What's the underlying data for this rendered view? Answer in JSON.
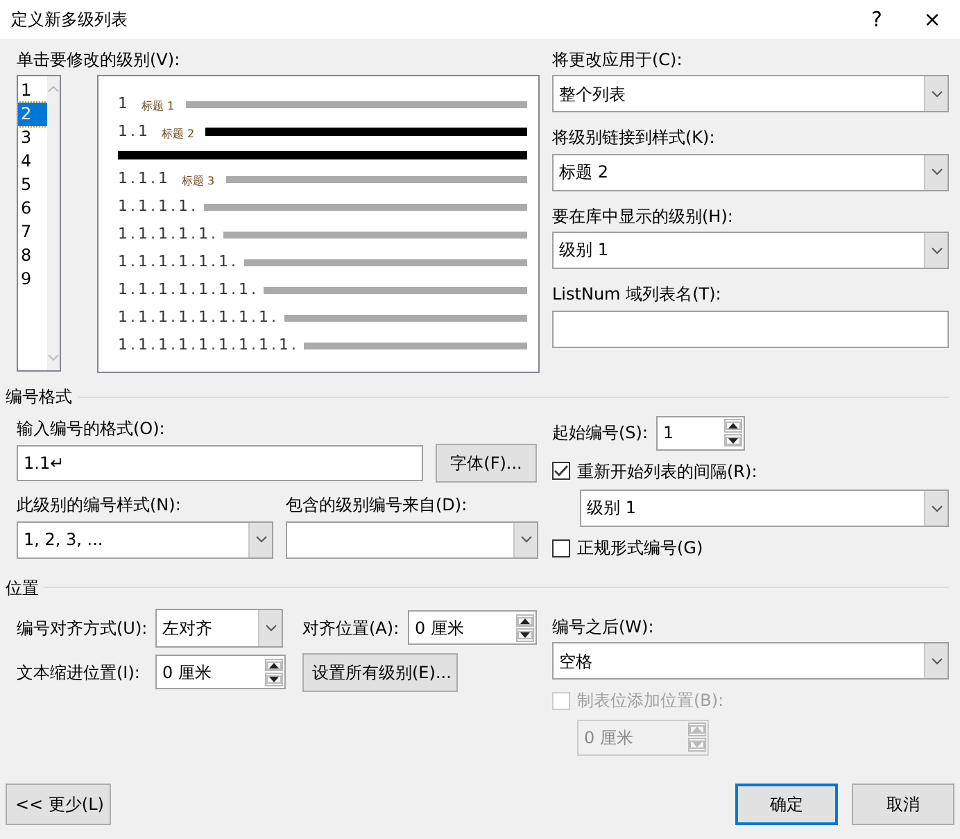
{
  "window": {
    "title": "定义新多级列表",
    "help": "?",
    "close": "×"
  },
  "levels_label": "单击要修改的级别(V):",
  "levels": [
    {
      "label": "1",
      "selected": false
    },
    {
      "label": "2",
      "selected": true
    },
    {
      "label": "3",
      "selected": false
    },
    {
      "label": "4",
      "selected": false
    },
    {
      "label": "5",
      "selected": false
    },
    {
      "label": "6",
      "selected": false
    },
    {
      "label": "7",
      "selected": false
    },
    {
      "label": "8",
      "selected": false
    },
    {
      "label": "9",
      "selected": false
    }
  ],
  "preview": [
    {
      "number": "1",
      "style": "标题 1",
      "selected": false
    },
    {
      "number": "1.1",
      "style": "标题 2",
      "selected": true
    },
    {
      "number": "1.1.1",
      "style": "标题 3",
      "selected": false
    },
    {
      "number": "1.1.1.1.",
      "selected": false
    },
    {
      "number": "1.1.1.1.1.",
      "selected": false
    },
    {
      "number": "1.1.1.1.1.1.",
      "selected": false
    },
    {
      "number": "1.1.1.1.1.1.1.",
      "selected": false
    },
    {
      "number": "1.1.1.1.1.1.1.1.",
      "selected": false
    },
    {
      "number": "1.1.1.1.1.1.1.1.1.",
      "selected": false
    }
  ],
  "apply_to": {
    "label": "将更改应用于(C):",
    "value": "整个列表"
  },
  "link_style": {
    "label": "将级别链接到样式(K):",
    "value": "标题 2"
  },
  "gallery_level": {
    "label": "要在库中显示的级别(H):",
    "value": "级别 1"
  },
  "listnum": {
    "label": "ListNum 域列表名(T):"
  },
  "number_format": {
    "title": "编号格式",
    "format_input": {
      "label": "输入编号的格式(O):",
      "value": "1.1↵"
    },
    "font_button": "字体(F)...",
    "number_style": {
      "label": "此级别的编号样式(N):",
      "value": "1, 2, 3, ..."
    },
    "include_level": {
      "label": "包含的级别编号来自(D):"
    },
    "start_at": {
      "label": "起始编号(S):",
      "value": "1"
    },
    "restart": {
      "label": "重新开始列表的间隔(R):",
      "checked": true
    },
    "restart_level": {
      "value": "级别 1"
    },
    "legal": {
      "label": "正规形式编号(G)",
      "checked": false
    }
  },
  "position": {
    "title": "位置",
    "alignment": {
      "label": "编号对齐方式(U):",
      "value": "左对齐"
    },
    "aligned_at": {
      "label": "对齐位置(A):",
      "value": "0 厘米"
    },
    "text_indent": {
      "label": "文本缩进位置(I):",
      "value": "0 厘米"
    },
    "set_all_button": "设置所有级别(E)...",
    "follow_with": {
      "label": "编号之后(W):",
      "value": "空格"
    },
    "tab_stop": {
      "label": "制表位添加位置(B):",
      "checked": false,
      "disabled": true
    },
    "tab_stop_at": {
      "value": "0 厘米",
      "disabled": true
    }
  },
  "buttons": [
    {
      "label": "<< 更少(L)",
      "default": false
    },
    {
      "label": "确定",
      "default": true
    },
    {
      "label": "取消",
      "default": false
    }
  ]
}
